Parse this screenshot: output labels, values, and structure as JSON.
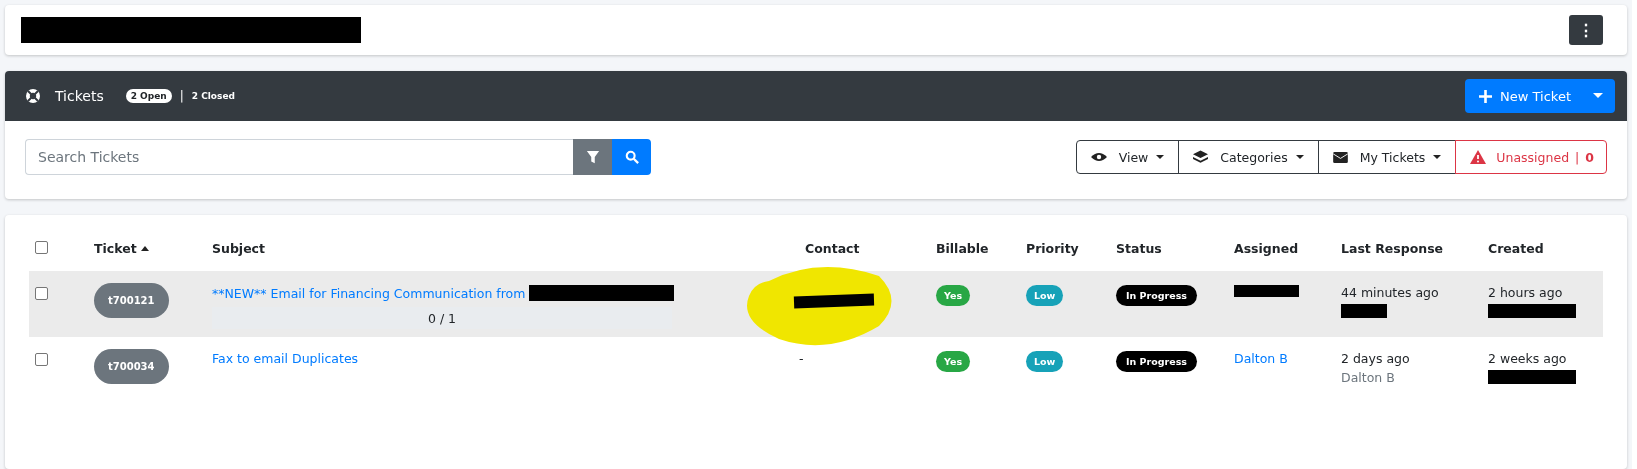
{
  "top_bar": {
    "title_redacted": true,
    "menu_button": "⋮"
  },
  "tickets_header": {
    "title": "Tickets",
    "open_count": "2 Open",
    "separator": "|",
    "closed_count": "2 Closed",
    "new_button": "New Ticket"
  },
  "search": {
    "placeholder": "Search Tickets"
  },
  "filters": [
    {
      "kind": "view",
      "label": "View"
    },
    {
      "kind": "categories",
      "label": "Categories"
    },
    {
      "kind": "mine",
      "label": "My Tickets"
    },
    {
      "kind": "unassigned",
      "label": "Unassigned",
      "separator": "|",
      "count": "0"
    }
  ],
  "table": {
    "select_all": {
      "checked": false
    },
    "columns": [
      {
        "label": "Ticket",
        "sorted": true
      },
      {
        "label": "Subject",
        "sorted": false
      },
      {
        "label": "Contact",
        "sorted": false
      },
      {
        "label": "Billable",
        "sorted": false
      },
      {
        "label": "Priority",
        "sorted": false
      },
      {
        "label": "Status",
        "sorted": false
      },
      {
        "label": "Assigned",
        "sorted": false
      },
      {
        "label": "Last Response",
        "sorted": false
      },
      {
        "label": "Created",
        "sorted": false
      }
    ],
    "rows": [
      {
        "checked": false,
        "highlighted": true,
        "ticket": "t700121",
        "subject": "**NEW** Email for Financing Communication from",
        "subject_redacted": true,
        "progress": {
          "text": "0 / 1",
          "level": 0
        },
        "contact_redacted": true,
        "billable": "Yes",
        "priority": "Low",
        "status": "In Progress",
        "assigned_redacted": true,
        "last_response": "44 minutes ago",
        "last_by_redacted": true,
        "created": "2 hours ago",
        "created_by_redacted": true
      },
      {
        "checked": false,
        "highlighted": false,
        "ticket": "t700034",
        "subject": "Fax to email Duplicates",
        "subject_redacted": false,
        "contact": "-",
        "contact_redacted": false,
        "billable": "Yes",
        "priority": "Low",
        "status": "In Progress",
        "assigned": "Dalton B",
        "assigned_redacted": false,
        "last_response": "2 days ago",
        "last_by": "Dalton B",
        "last_by_redacted": false,
        "created": "2 weeks ago",
        "created_by_redacted": true
      }
    ]
  }
}
